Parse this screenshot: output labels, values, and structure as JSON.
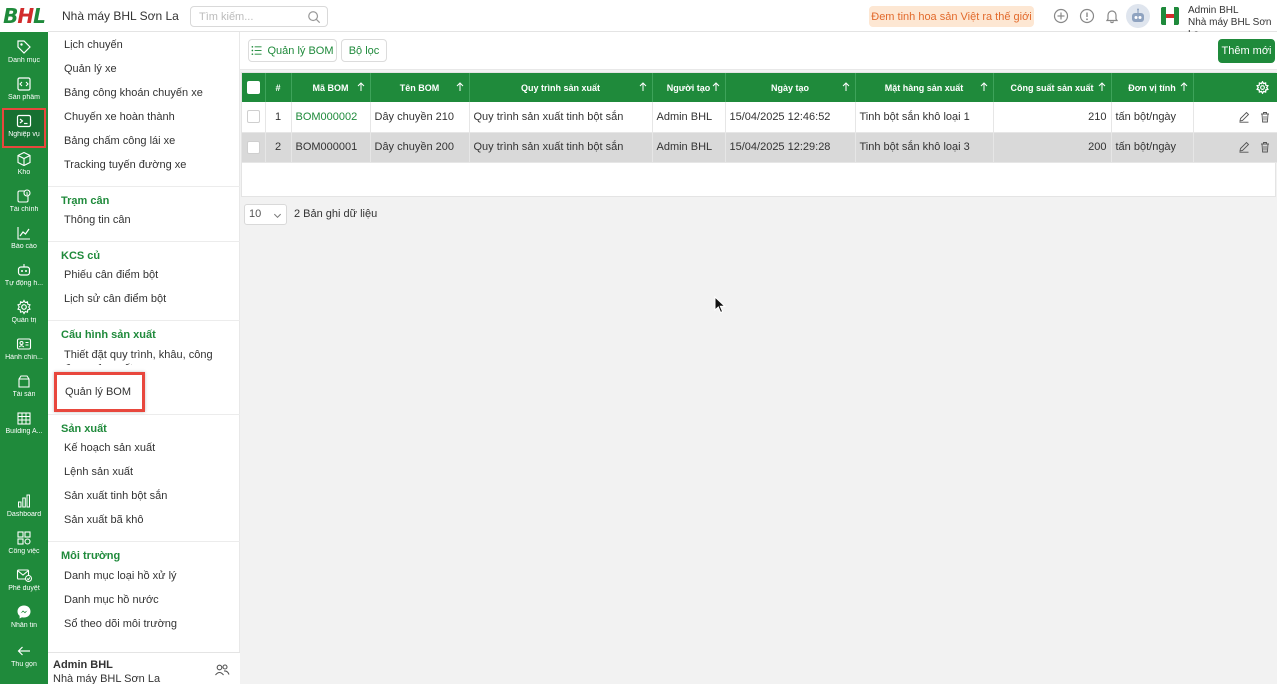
{
  "header": {
    "logo_text_b": "B",
    "logo_text_h": "H",
    "logo_text_l": "L",
    "factory_name": "Nhà máy BHL Sơn La",
    "search_placeholder": "Tìm kiếm...",
    "slogan": "Đem tinh hoa sản Việt ra thế giới",
    "user_name": "Admin BHL",
    "user_factory": "Nhà máy BHL Sơn La"
  },
  "rail": {
    "items": [
      {
        "label": "Danh mục",
        "icon": "tag-icon"
      },
      {
        "label": "Sản phẩm",
        "icon": "box-code-icon"
      },
      {
        "label": "Nghiệp vụ",
        "icon": "terminal-icon"
      },
      {
        "label": "Kho",
        "icon": "cube-icon"
      },
      {
        "label": "Tài chính",
        "icon": "finance-icon"
      },
      {
        "label": "Báo cáo",
        "icon": "chart-line-icon"
      },
      {
        "label": "Tự động h...",
        "icon": "robot-icon"
      },
      {
        "label": "Quản trị",
        "icon": "gear-icon"
      },
      {
        "label": "Hành chín...",
        "icon": "id-card-icon"
      },
      {
        "label": "Tài sản",
        "icon": "asset-icon"
      },
      {
        "label": "Building A...",
        "icon": "building-icon"
      },
      {
        "label": "Dashboard",
        "icon": "bar-chart-icon"
      },
      {
        "label": "Công việc",
        "icon": "grid-icon"
      },
      {
        "label": "Phê duyệt",
        "icon": "mail-check-icon"
      },
      {
        "label": "Nhắn tin",
        "icon": "messenger-icon"
      },
      {
        "label": "Thu gọn",
        "icon": "arrow-left-icon"
      }
    ]
  },
  "submenu": {
    "transport": [
      "Lịch chuyến",
      "Quản lý xe",
      "Bảng công khoán chuyến xe",
      "Chuyến xe hoàn thành",
      "Bảng chấm công lái xe",
      "Tracking tuyến đường xe"
    ],
    "weigh_station": {
      "title": "Trạm cân",
      "items": [
        "Thông tin cân"
      ]
    },
    "kcs": {
      "title": "KCS củ",
      "items": [
        "Phiếu cân điểm bột",
        "Lịch sử cân điểm bột"
      ]
    },
    "production_config": {
      "title": "Cấu hình sản xuất",
      "items": [
        "Thiết đặt quy trình, khâu, công đoạn sản xuất",
        "Quản lý BOM"
      ]
    },
    "production": {
      "title": "Sản xuất",
      "items": [
        "Kế hoạch sản xuất",
        "Lệnh sản xuất",
        "Sản xuất tinh bột sắn",
        "Sản xuất bã khô"
      ]
    },
    "environment": {
      "title": "Môi trường",
      "items": [
        "Danh mục loại hồ xử lý",
        "Danh mục hồ nước",
        "Sổ theo dõi môi trường"
      ]
    },
    "footer_name": "Admin BHL",
    "footer_factory": "Nhà máy BHL Sơn La"
  },
  "toolbar": {
    "tab_bom": "Quản lý BOM",
    "filter": "Bộ lọc",
    "add_new": "Thêm mới"
  },
  "table": {
    "columns": [
      "#",
      "Mã BOM",
      "Tên BOM",
      "Quy trình sản xuất",
      "Người tạo",
      "Ngày tạo",
      "Mặt hàng sản xuất",
      "Công suất sản xuất",
      "Đơn vị tính"
    ],
    "rows": [
      {
        "index": "1",
        "code": "BOM000002",
        "name": "Dây chuyền 210",
        "process": "Quy trình sản xuất tinh bột sắn",
        "creator": "Admin BHL",
        "created": "15/04/2025 12:46:52",
        "product": "Tinh bột sắn khô loại 1",
        "capacity": "210",
        "unit": "tấn bột/ngày"
      },
      {
        "index": "2",
        "code": "BOM000001",
        "name": "Dây chuyền 200",
        "process": "Quy trình sản xuất tinh bột sắn",
        "creator": "Admin BHL",
        "created": "15/04/2025 12:29:28",
        "product": "Tinh bột sắn khô loại 3",
        "capacity": "200",
        "unit": "tấn bột/ngày"
      }
    ],
    "page_size": "10",
    "record_info": "2 Bản ghi dữ liệu"
  },
  "colors": {
    "brand": "#1f8a3b",
    "highlight": "#e8473d",
    "slogan_bg": "#fde7d3",
    "slogan_text": "#e26a2c"
  }
}
